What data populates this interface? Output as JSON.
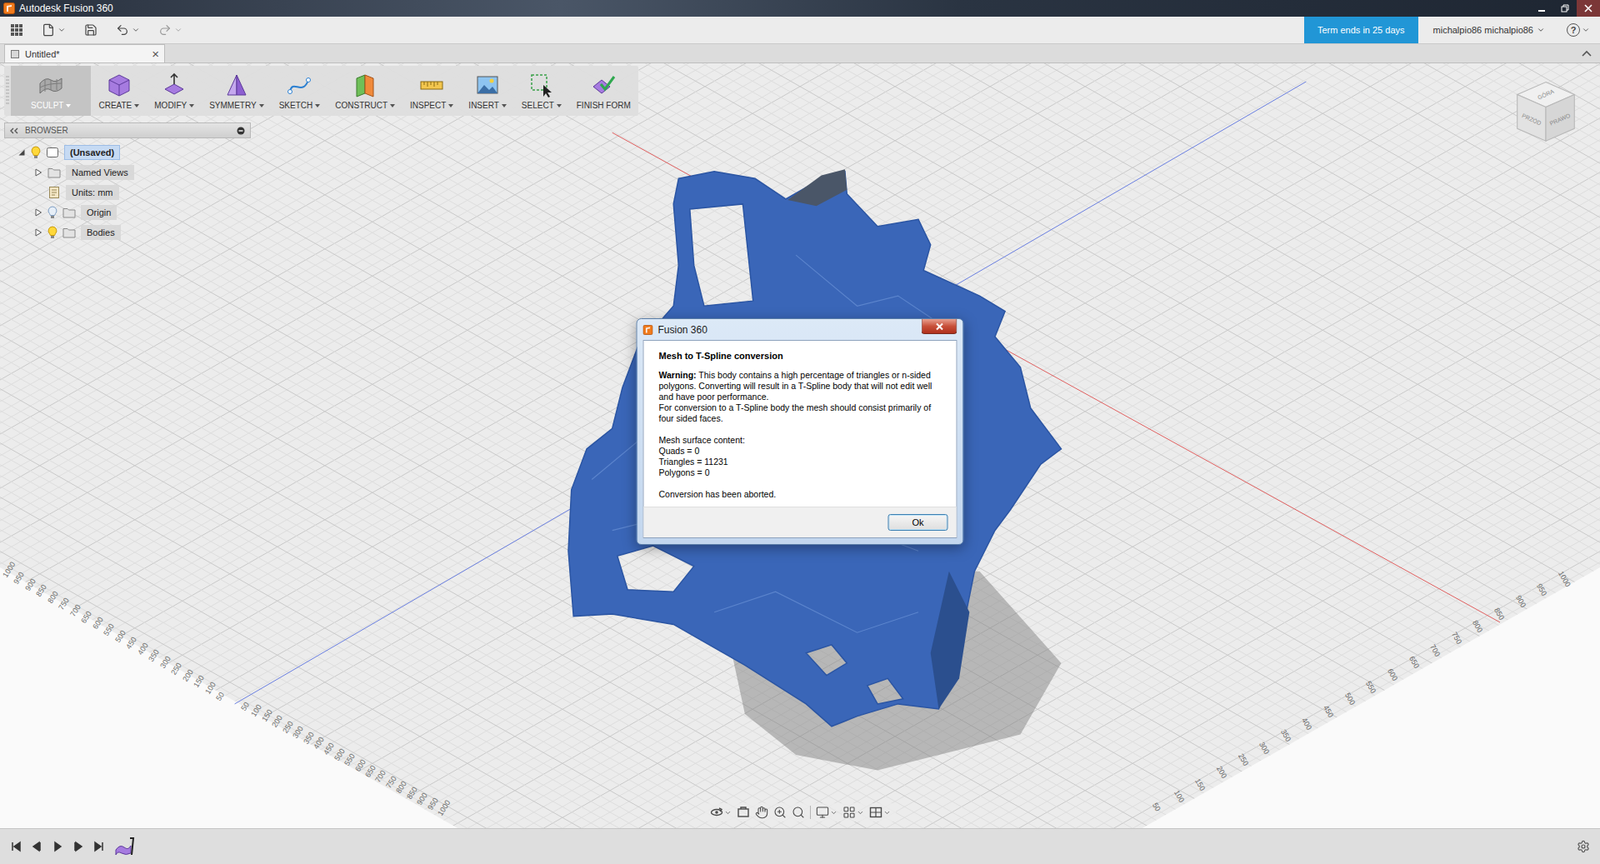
{
  "window": {
    "title": "Autodesk Fusion 360"
  },
  "quick_access": {
    "term_badge": "Term ends in 25 days",
    "user": "michalpio86 michalpio86",
    "help": "?"
  },
  "tabs": [
    {
      "label": "Untitled*",
      "selected": true,
      "close": "×"
    }
  ],
  "toolbar": [
    {
      "label": "SCULPT",
      "selected": true,
      "dropdown": true
    },
    {
      "label": "CREATE",
      "selected": false,
      "dropdown": true
    },
    {
      "label": "MODIFY",
      "selected": false,
      "dropdown": true
    },
    {
      "label": "SYMMETRY",
      "selected": false,
      "dropdown": true
    },
    {
      "label": "SKETCH",
      "selected": false,
      "dropdown": true
    },
    {
      "label": "CONSTRUCT",
      "selected": false,
      "dropdown": true
    },
    {
      "label": "INSPECT",
      "selected": false,
      "dropdown": true
    },
    {
      "label": "INSERT",
      "selected": false,
      "dropdown": true
    },
    {
      "label": "SELECT",
      "selected": false,
      "dropdown": true
    },
    {
      "label": "FINISH FORM",
      "selected": false,
      "dropdown": false
    }
  ],
  "browser": {
    "title": "BROWSER",
    "root": {
      "label": "(Unsaved)",
      "kind": "component",
      "selected": true,
      "expanded": true,
      "visible": true,
      "children": [
        {
          "label": "Named Views",
          "kind": "folder",
          "selected": false,
          "expanded": false,
          "visible": null
        },
        {
          "label": "Units: mm",
          "kind": "units",
          "selected": false,
          "expanded": null,
          "visible": null
        },
        {
          "label": "Origin",
          "kind": "folder",
          "selected": false,
          "expanded": false,
          "visible": false
        },
        {
          "label": "Bodies",
          "kind": "folder",
          "selected": false,
          "expanded": false,
          "visible": true
        }
      ]
    }
  },
  "viewcube": {
    "top": "GÓRA",
    "front": "PRZÓD",
    "right": "PRAWO"
  },
  "rulers": [
    {
      "labels": [
        "1000",
        "950",
        "900",
        "850",
        "800",
        "750",
        "700",
        "650",
        "600",
        "550",
        "500",
        "450",
        "400",
        "350",
        "300",
        "250",
        "200",
        "150",
        "100",
        "50"
      ]
    },
    {
      "labels": [
        "50",
        "100",
        "150",
        "200",
        "250",
        "300",
        "350",
        "400",
        "450",
        "500",
        "550",
        "600",
        "650",
        "700",
        "750",
        "800",
        "850",
        "900",
        "950",
        "1000"
      ]
    },
    {
      "labels": [
        "50",
        "100",
        "150",
        "200",
        "250",
        "300",
        "350",
        "400",
        "450",
        "500",
        "550",
        "600",
        "650",
        "700",
        "750",
        "800",
        "850",
        "900",
        "950",
        "1000"
      ]
    }
  ],
  "dialog": {
    "title": "Fusion 360",
    "heading": "Mesh to T-Spline conversion",
    "warning_label": "Warning:",
    "warning": "This body contains a high percentage of triangles or n-sided polygons. Converting will result in a T-Spline body that will not edit well and have poor performance.",
    "note": "For conversion to a T-Spline body the mesh should consist primarily of four sided faces.",
    "content_title": "Mesh surface content:",
    "content": [
      "Quads = 0",
      "Triangles = 11231",
      "Polygons = 0"
    ],
    "status": "Conversion has been aborted.",
    "buttons": [
      "Ok"
    ]
  }
}
